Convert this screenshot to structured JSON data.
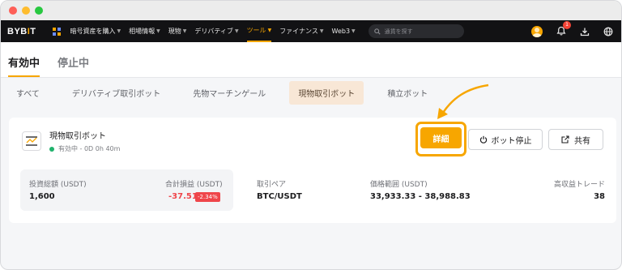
{
  "brand": {
    "logo_prefix": "BYB",
    "logo_mark": "I",
    "logo_suffix": "T",
    "accent": "#f7a600"
  },
  "nav": {
    "items": [
      {
        "label": "暗号資産を購入"
      },
      {
        "label": "相場情報"
      },
      {
        "label": "現物"
      },
      {
        "label": "デリバティブ"
      },
      {
        "label": "ツール",
        "active": true
      },
      {
        "label": "ファイナンス"
      },
      {
        "label": "Web3"
      }
    ],
    "search_placeholder": "通貨を探す",
    "notification_count": "1"
  },
  "status_tabs": [
    {
      "label": "有効中",
      "active": true
    },
    {
      "label": "停止中"
    }
  ],
  "type_tabs": [
    {
      "label": "すべて"
    },
    {
      "label": "デリバティブ取引ボット"
    },
    {
      "label": "先物マーチンゲール"
    },
    {
      "label": "現物取引ボット",
      "active": true
    },
    {
      "label": "積立ボット"
    }
  ],
  "card": {
    "bot_name": "現物取引ボット",
    "status_text": "有効中 - 0D 0h 40m",
    "detail_label": "詳細",
    "stop_label": "ボット停止",
    "share_label": "共有",
    "investment_label": "投資総額 (USDT)",
    "investment_value": "1,600",
    "pnl_label": "合計損益 (USDT)",
    "pnl_value": "-37.51",
    "pnl_pct": "-2.34%",
    "pair_label": "取引ペア",
    "pair_value": "BTC/USDT",
    "range_label": "価格範囲 (USDT)",
    "range_value": "33,933.33 - 38,988.83",
    "trades_label": "高収益トレード",
    "trades_value": "38"
  }
}
